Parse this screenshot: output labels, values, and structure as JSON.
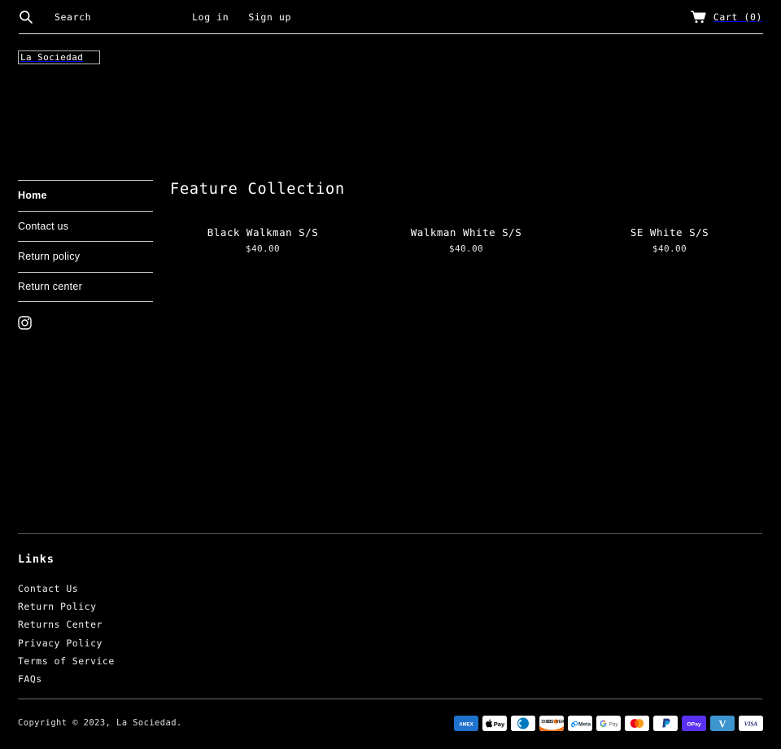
{
  "header": {
    "search_icon": "search-icon",
    "search_label": "Search",
    "login_label": "Log in",
    "signup_label": "Sign up",
    "cart_icon": "shopping-cart-icon",
    "cart_label": "Cart (0)"
  },
  "logo": {
    "text": "La Sociedad"
  },
  "sidebar": {
    "items": [
      {
        "label": "Home",
        "active": true
      },
      {
        "label": "Contact us",
        "active": false
      },
      {
        "label": "Return policy",
        "active": false
      },
      {
        "label": "Return center",
        "active": false
      }
    ],
    "social": [
      {
        "icon": "instagram-icon",
        "name": "Instagram"
      }
    ]
  },
  "main": {
    "collection_title": "Feature Collection",
    "products": [
      {
        "title": "Black Walkman S/S",
        "price": "$40.00",
        "thumb_height": 299
      },
      {
        "title": "Walkman White S/S",
        "price": "$40.00",
        "thumb_height": 224
      },
      {
        "title": "SE White S/S",
        "price": "$40.00",
        "thumb_height": 224
      }
    ]
  },
  "footer": {
    "heading": "Links",
    "links": [
      "Contact Us",
      "Return Policy",
      "Returns Center",
      "Privacy Policy",
      "Terms of Service",
      "FAQs"
    ],
    "copyright": "Copyright © 2023, La Sociedad.",
    "payment_methods": [
      {
        "name": "american-express",
        "label": "AMEX",
        "bg": "#1F72CD",
        "fg": "#ffffff"
      },
      {
        "name": "apple-pay",
        "label": "Pay",
        "bg": "#ffffff",
        "fg": "#000000"
      },
      {
        "name": "diners-club",
        "label": "DC",
        "bg": "#ffffff",
        "fg": "#0079BE"
      },
      {
        "name": "discover",
        "label": "DISCOVER",
        "bg": "#ffffff",
        "fg": "#F47216"
      },
      {
        "name": "meta-pay",
        "label": "Meta",
        "bg": "#ffffff",
        "fg": "#0082FB"
      },
      {
        "name": "google-pay",
        "label": "G Pay",
        "bg": "#ffffff",
        "fg": "#5F6368"
      },
      {
        "name": "mastercard",
        "label": "MC",
        "bg": "#ffffff",
        "fg": "#EB001B"
      },
      {
        "name": "paypal",
        "label": "PayPal",
        "bg": "#ffffff",
        "fg": "#253B80"
      },
      {
        "name": "shop-pay",
        "label": "OPay",
        "bg": "#5A31F4",
        "fg": "#ffffff"
      },
      {
        "name": "venmo",
        "label": "V",
        "bg": "#3D95CE",
        "fg": "#ffffff"
      },
      {
        "name": "visa",
        "label": "VISA",
        "bg": "#ffffff",
        "fg": "#1A1F71"
      }
    ]
  },
  "colors": {
    "background": "#000000",
    "text": "#ffffff",
    "thumb": "#0c0c0c",
    "rule_bright": "#e8e8e8",
    "rule_dim": "#575757"
  }
}
